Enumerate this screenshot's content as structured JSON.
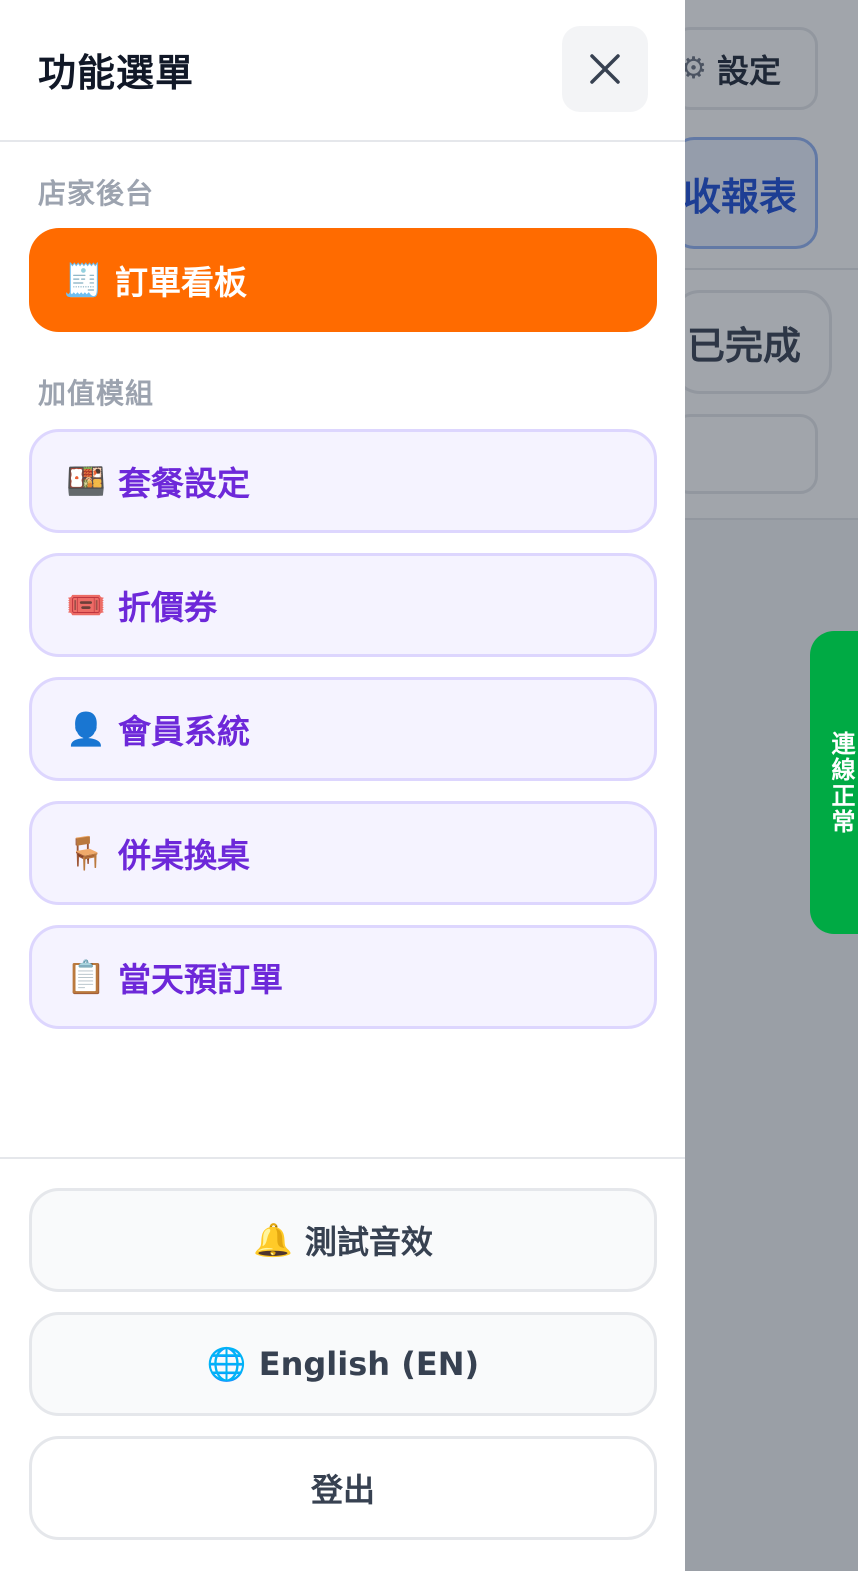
{
  "background": {
    "settings_label": "設定",
    "report_label": "收報表",
    "done_tab_label": "已完成",
    "connection_status": "連線正常"
  },
  "drawer": {
    "title": "功能選單",
    "close_icon": "close-icon",
    "sections": {
      "store_admin": {
        "label": "店家後台",
        "items": [
          {
            "icon": "🧾",
            "label": "訂單看板",
            "active": true
          }
        ]
      },
      "addons": {
        "label": "加值模組",
        "items": [
          {
            "icon": "🍱",
            "label": "套餐設定"
          },
          {
            "icon": "🎟️",
            "label": "折價券"
          },
          {
            "icon": "👤",
            "label": "會員系統"
          },
          {
            "icon": "🪑",
            "label": "併桌換桌"
          },
          {
            "icon": "📋",
            "label": "當天預訂單"
          }
        ]
      }
    },
    "footer": {
      "test_sound": {
        "icon": "🔔",
        "label": "測試音效"
      },
      "language": {
        "icon": "🌐",
        "label": "English (EN)"
      },
      "logout": {
        "label": "登出"
      }
    }
  },
  "colors": {
    "active_item": "#ff6b00",
    "addon_text": "#6d28d9",
    "addon_bg": "#f5f3ff",
    "status_green": "#00aa44",
    "report_blue": "#1d4ed8"
  }
}
